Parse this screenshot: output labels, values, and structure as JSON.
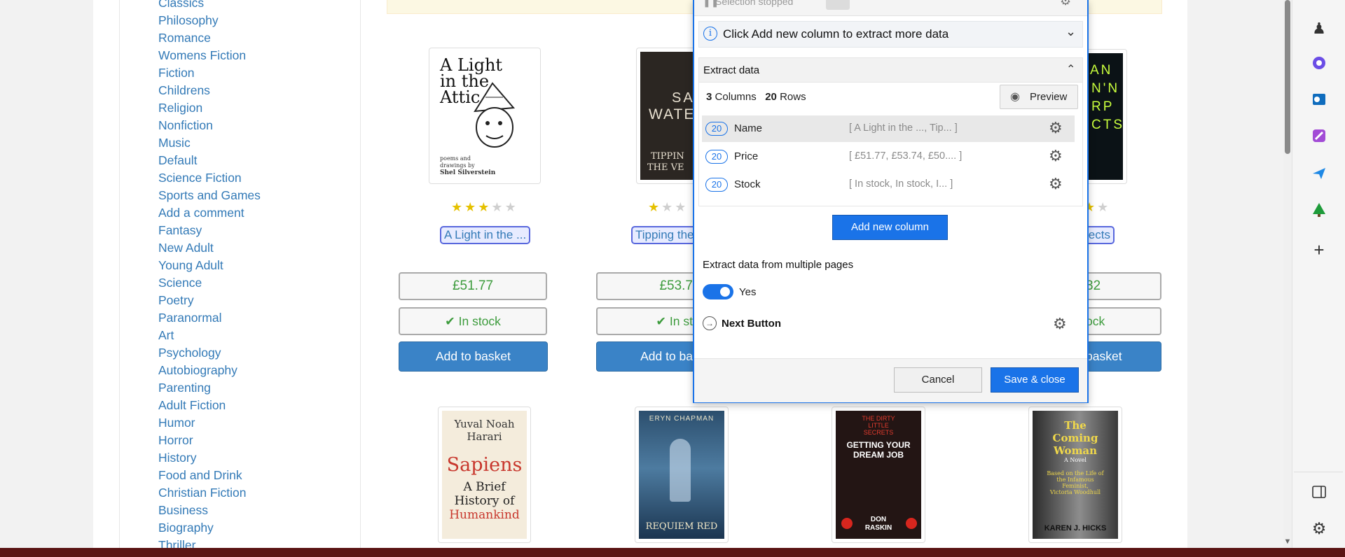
{
  "sidebar": {
    "categories": [
      "Classics",
      "Philosophy",
      "Romance",
      "Womens Fiction",
      "Fiction",
      "Childrens",
      "Religion",
      "Nonfiction",
      "Music",
      "Default",
      "Science Fiction",
      "Sports and Games",
      "Add a comment",
      "Fantasy",
      "New Adult",
      "Young Adult",
      "Science",
      "Poetry",
      "Paranormal",
      "Art",
      "Psychology",
      "Autobiography",
      "Parenting",
      "Adult Fiction",
      "Humor",
      "Horror",
      "History",
      "Food and Drink",
      "Christian Fiction",
      "Business",
      "Biography",
      "Thriller"
    ]
  },
  "products": [
    {
      "title": "A Light in the ...",
      "price": "£51.77",
      "stock": "In stock",
      "button": "Add to basket",
      "rating": 3,
      "cover": {
        "line1": "A Light",
        "line2": "in the",
        "line3": "Attic",
        "sub1": "poems and",
        "sub2": "drawings by",
        "author": "Shel Silverstein"
      }
    },
    {
      "title": "Tipping the",
      "price": "£53.7",
      "stock": "In st",
      "button": "Add to ba",
      "rating": 1,
      "cover": {
        "line1": "SARA",
        "line2": "WATE",
        "line3": "TIPPIN",
        "line4": "THE VE"
      }
    },
    {
      "title": "jects",
      "price": "32",
      "stock": "ock",
      "button": "basket",
      "rating": 4,
      "cover": {
        "line1": "AN",
        "line2": "N'N",
        "line3": "RP",
        "line4": "CTS"
      }
    }
  ],
  "row2_covers": [
    {
      "line1": "Yuval Noah",
      "line2": "Harari",
      "line3": "Sapiens",
      "line4": "A Brief",
      "line5": "History of",
      "line6": "Humankind"
    },
    {
      "line1": "ERYN CHAPMAN",
      "line2": "REQUIEM RED"
    },
    {
      "line1": "THE DIRTY",
      "line2": "LITTLE",
      "line3": "SECRETS",
      "line4": "GETTING YOUR",
      "line5": "DREAM JOB",
      "line6": "DON",
      "line7": "RASKIN"
    },
    {
      "line1": "The",
      "line2": "Coming",
      "line3": "Woman",
      "line4": "A Novel",
      "line5": "Based on the Life of",
      "line6": "the Infamous",
      "line7": "Feminist,",
      "line8": "Victoria Woodhull",
      "line9": "KAREN J. HICKS"
    }
  ],
  "dialog": {
    "top_status": "Selection stopped",
    "info_banner": "Click Add new column to extract more data",
    "section_title": "Extract data",
    "columns_count": "3",
    "columns_label": "Columns",
    "rows_count": "20",
    "rows_label": "Rows",
    "preview_label": "Preview",
    "columns": [
      {
        "count": "20",
        "name": "Name",
        "sample": "[ A Light in the ..., Tip... ]"
      },
      {
        "count": "20",
        "name": "Price",
        "sample": "[ £51.77, £53.74, £50.... ]"
      },
      {
        "count": "20",
        "name": "Stock",
        "sample": "[  In stock,  In stock,  I... ]"
      }
    ],
    "add_column_label": "Add new column",
    "multi_page_label": "Extract data from multiple pages",
    "toggle_label": "Yes",
    "toggle_on": true,
    "next_button_label": "Next Button",
    "cancel_label": "Cancel",
    "save_label": "Save & close"
  },
  "colors": {
    "accent": "#1a73e8",
    "link": "#337ab7",
    "price": "#3c9b3c",
    "basket": "#3a83c7"
  }
}
